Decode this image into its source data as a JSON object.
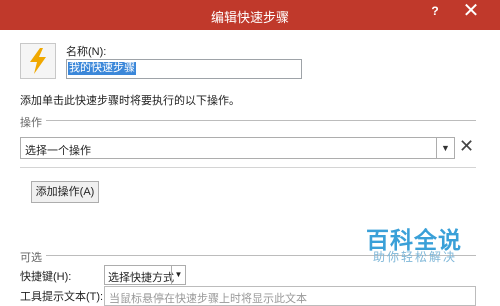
{
  "window": {
    "title": "编辑快速步骤",
    "help": "?",
    "close": "✕"
  },
  "name": {
    "label": "名称(N):",
    "value": "我的快速步骤"
  },
  "description": "添加单击此快速步骤时将要执行的以下操作。",
  "operations": {
    "section_label": "操作",
    "action_select_value": "选择一个操作",
    "remove": "✕",
    "add_button": "添加操作(A)"
  },
  "optional": {
    "section_label": "可选",
    "shortcut_label": "快捷键(H):",
    "shortcut_value": "选择快捷方式",
    "tooltip_label": "工具提示文本(T):",
    "tooltip_placeholder": "当鼠标悬停在快速步骤上时将显示此文本"
  },
  "watermark": {
    "main": "百科全说",
    "sub": "助你轻松解决"
  },
  "colors": {
    "titlebar": "#c0392b",
    "selection": "#3b87d9",
    "icon_bolt": "#f0a800"
  }
}
